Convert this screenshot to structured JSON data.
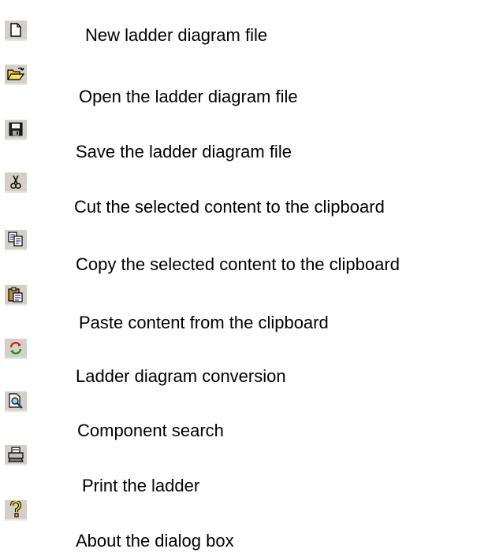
{
  "toolbar_help": {
    "items": [
      {
        "icon": "new-file-icon",
        "label": "New ladder diagram file"
      },
      {
        "icon": "open-folder-icon",
        "label": "Open the ladder diagram file"
      },
      {
        "icon": "save-disk-icon",
        "label": "Save the ladder diagram file"
      },
      {
        "icon": "scissors-icon",
        "label": "Cut the selected content to the clipboard"
      },
      {
        "icon": "copy-icon",
        "label": "Copy the selected content to the clipboard"
      },
      {
        "icon": "paste-icon",
        "label": "Paste content from the clipboard"
      },
      {
        "icon": "convert-icon",
        "label": "Ladder diagram conversion"
      },
      {
        "icon": "search-icon",
        "label": "Component search"
      },
      {
        "icon": "printer-icon",
        "label": "Print the ladder"
      },
      {
        "icon": "help-icon",
        "label": "About the dialog box"
      }
    ]
  }
}
